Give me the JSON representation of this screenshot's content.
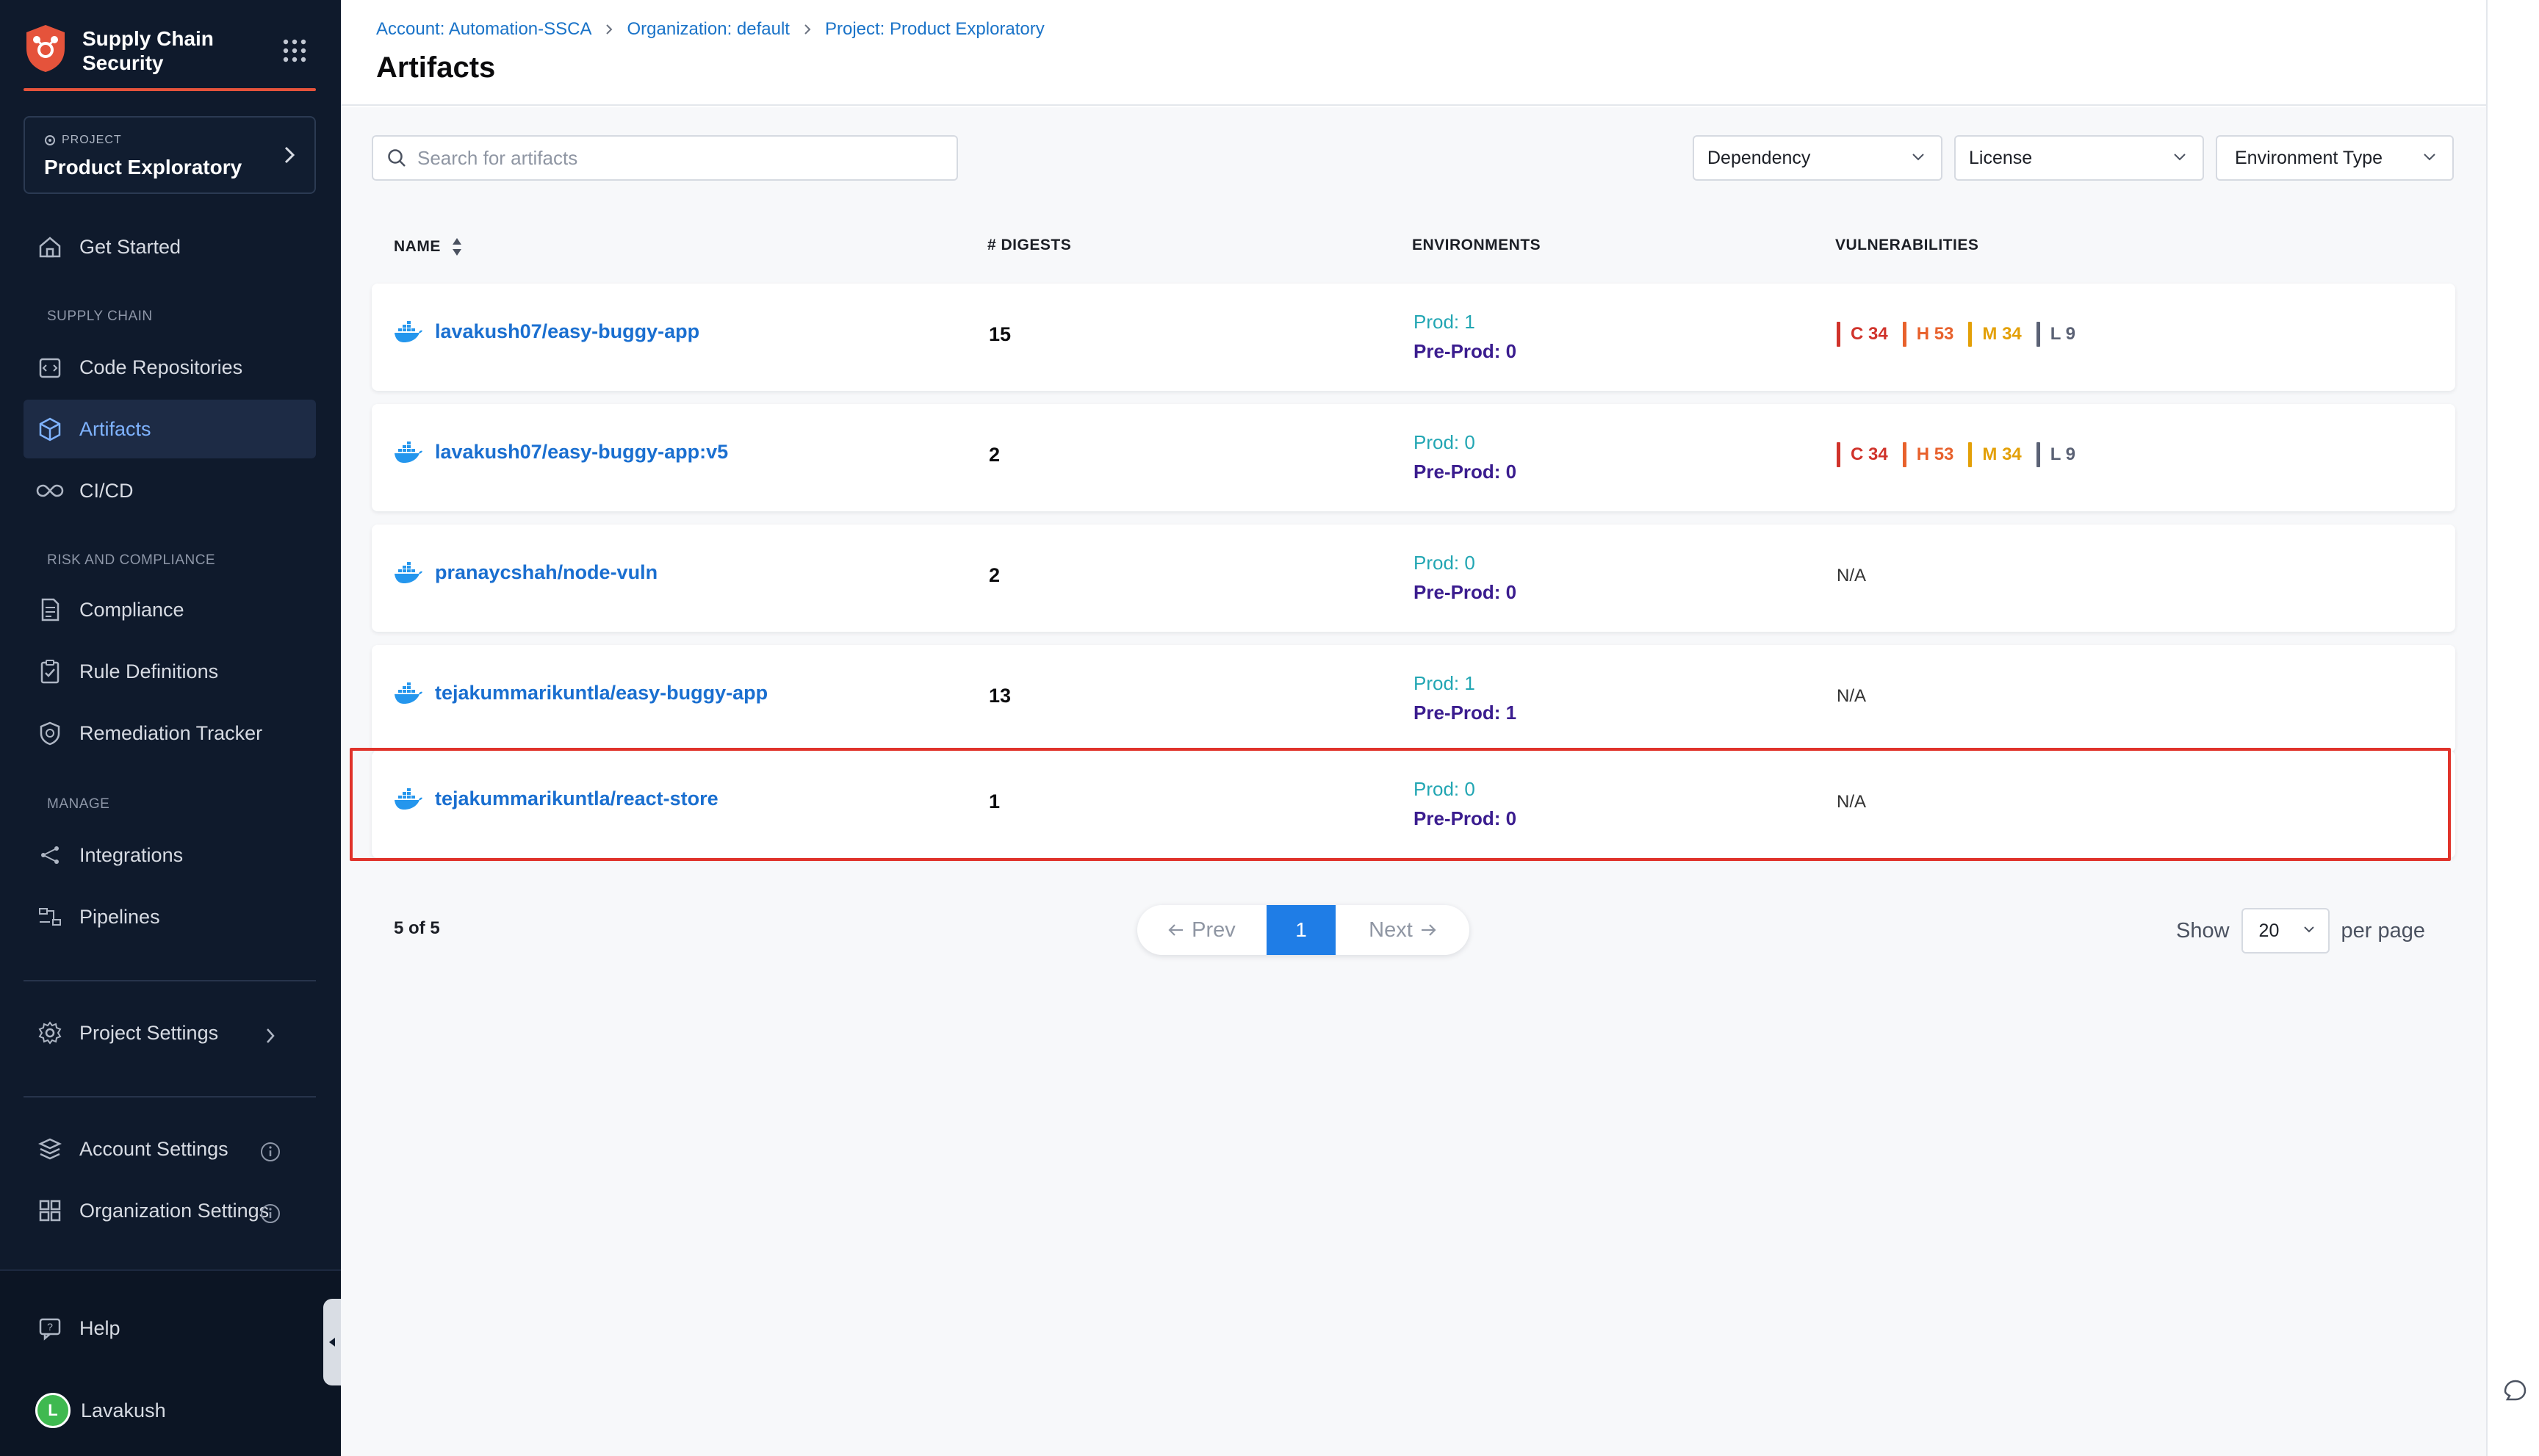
{
  "app": {
    "title": "Supply Chain Security",
    "title_line1": "Supply Chain",
    "title_line2": "Security",
    "accent": "#e5533b"
  },
  "project": {
    "label": "PROJECT",
    "name": "Product Exploratory"
  },
  "sidebar": {
    "get_started": "Get Started",
    "sections": {
      "supply_chain": "SUPPLY CHAIN",
      "risk": "RISK AND COMPLIANCE",
      "manage": "MANAGE"
    },
    "items": {
      "code_repositories": "Code Repositories",
      "artifacts": "Artifacts",
      "cicd": "CI/CD",
      "compliance": "Compliance",
      "rule_definitions": "Rule Definitions",
      "remediation_tracker": "Remediation Tracker",
      "integrations": "Integrations",
      "pipelines": "Pipelines",
      "project_settings": "Project Settings",
      "account_settings": "Account Settings",
      "organization_settings": "Organization Settings",
      "help": "Help"
    },
    "user": {
      "initial": "L",
      "name": "Lavakush"
    }
  },
  "breadcrumb": {
    "account": "Account: Automation-SSCA",
    "organization": "Organization: default",
    "project": "Project: Product Exploratory"
  },
  "page_title": "Artifacts",
  "search": {
    "placeholder": "Search for artifacts",
    "value": ""
  },
  "filters": {
    "dependency": "Dependency",
    "license": "License",
    "environment_type": "Environment Type"
  },
  "table": {
    "headers": {
      "name": "NAME",
      "digests": "# DIGESTS",
      "environments": "ENVIRONMENTS",
      "vulnerabilities": "VULNERABILITIES"
    },
    "rows": [
      {
        "name": "lavakush07/easy-buggy-app",
        "digests": "15",
        "prod": "Prod: 1",
        "preprod": "Pre-Prod: 0",
        "vulns": {
          "c": "C 34",
          "h": "H 53",
          "m": "M 34",
          "l": "L 9"
        }
      },
      {
        "name": "lavakush07/easy-buggy-app:v5",
        "digests": "2",
        "prod": "Prod: 0",
        "preprod": "Pre-Prod: 0",
        "vulns": {
          "c": "C 34",
          "h": "H 53",
          "m": "M 34",
          "l": "L 9"
        }
      },
      {
        "name": "pranaycshah/node-vuln",
        "digests": "2",
        "prod": "Prod: 0",
        "preprod": "Pre-Prod: 0",
        "na": "N/A"
      },
      {
        "name": "tejakummarikuntla/easy-buggy-app",
        "digests": "13",
        "prod": "Prod: 1",
        "preprod": "Pre-Prod: 1",
        "na": "N/A"
      },
      {
        "name": "tejakummarikuntla/react-store",
        "digests": "1",
        "prod": "Prod: 0",
        "preprod": "Pre-Prod: 0",
        "na": "N/A"
      }
    ]
  },
  "vuln_colors": {
    "critical": "#d0332b",
    "high": "#e8612c",
    "medium": "#e3a008",
    "low": "#5b6275"
  },
  "pagination": {
    "count": "5 of 5",
    "prev": "Prev",
    "current": "1",
    "next": "Next",
    "show_label": "Show",
    "per_page_value": "20",
    "per_page_label": "per page"
  }
}
